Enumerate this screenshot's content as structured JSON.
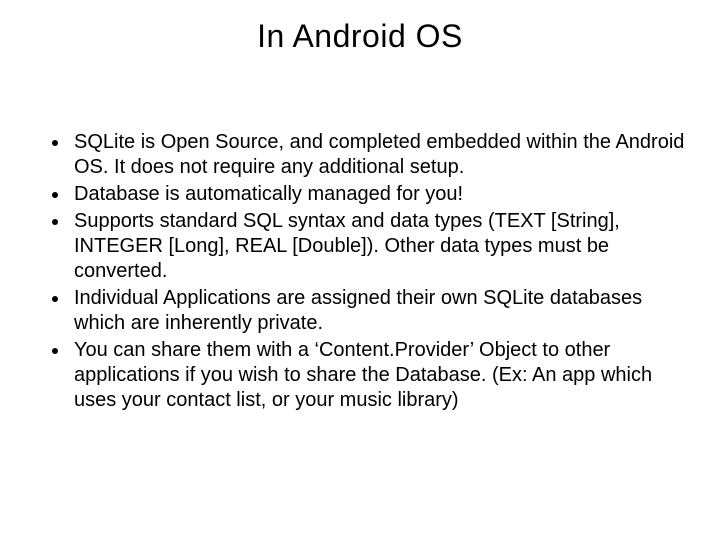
{
  "slide": {
    "title": "In Android OS",
    "bullets": [
      "SQLite is Open Source, and completed embedded within the Android OS.  It does not require any additional setup.",
      "Database is automatically managed for you!",
      "Supports standard SQL syntax and data types (TEXT [String], INTEGER [Long], REAL [Double]).  Other data types must be converted.",
      "Individual Applications are assigned their own SQLite databases which are inherently private.",
      "You can share them with a ‘Content.Provider’ Object to other applications if you wish to share the Database.  (Ex: An app which uses your contact list, or your music library)"
    ]
  }
}
